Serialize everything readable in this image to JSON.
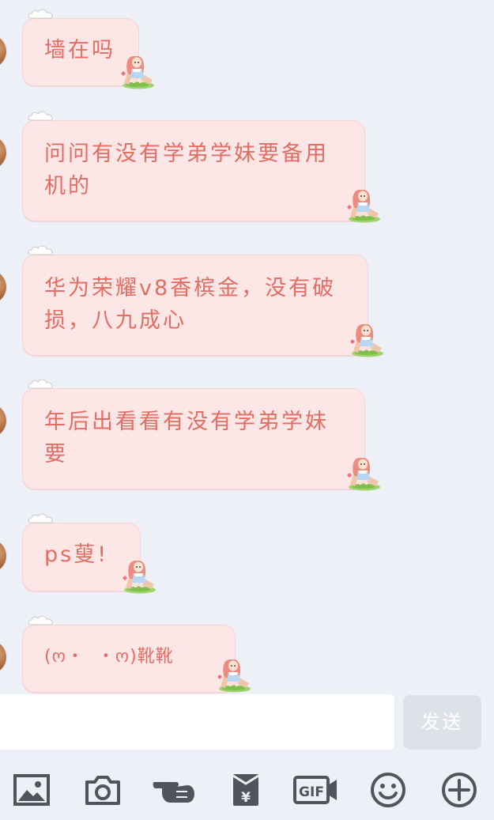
{
  "messages": [
    {
      "text": "墙在吗"
    },
    {
      "text": "问问有没有学弟学妹要备用\n机的"
    },
    {
      "text": "华为荣耀v8香槟金，没有破\n损，八九成心"
    },
    {
      "text": "年后出看看有没有学弟学妹\n要"
    },
    {
      "text": "ps蓃!"
    },
    {
      "text": "(ო・  ・ო)靴靴"
    }
  ],
  "composer": {
    "input_value": "",
    "send_label": "发送"
  },
  "toolbar": {
    "items": [
      {
        "icon": "image-icon"
      },
      {
        "icon": "camera-icon"
      },
      {
        "icon": "poke-hand-icon"
      },
      {
        "icon": "red-packet-icon"
      },
      {
        "icon": "gif-icon"
      },
      {
        "icon": "emoji-icon"
      },
      {
        "icon": "plus-icon"
      }
    ]
  },
  "colors": {
    "background": "#edf1f7",
    "bubble": "#fde6e6",
    "bubble_text": "#e26d62",
    "icon": "#50555d",
    "send_button": "#dee2e8"
  }
}
